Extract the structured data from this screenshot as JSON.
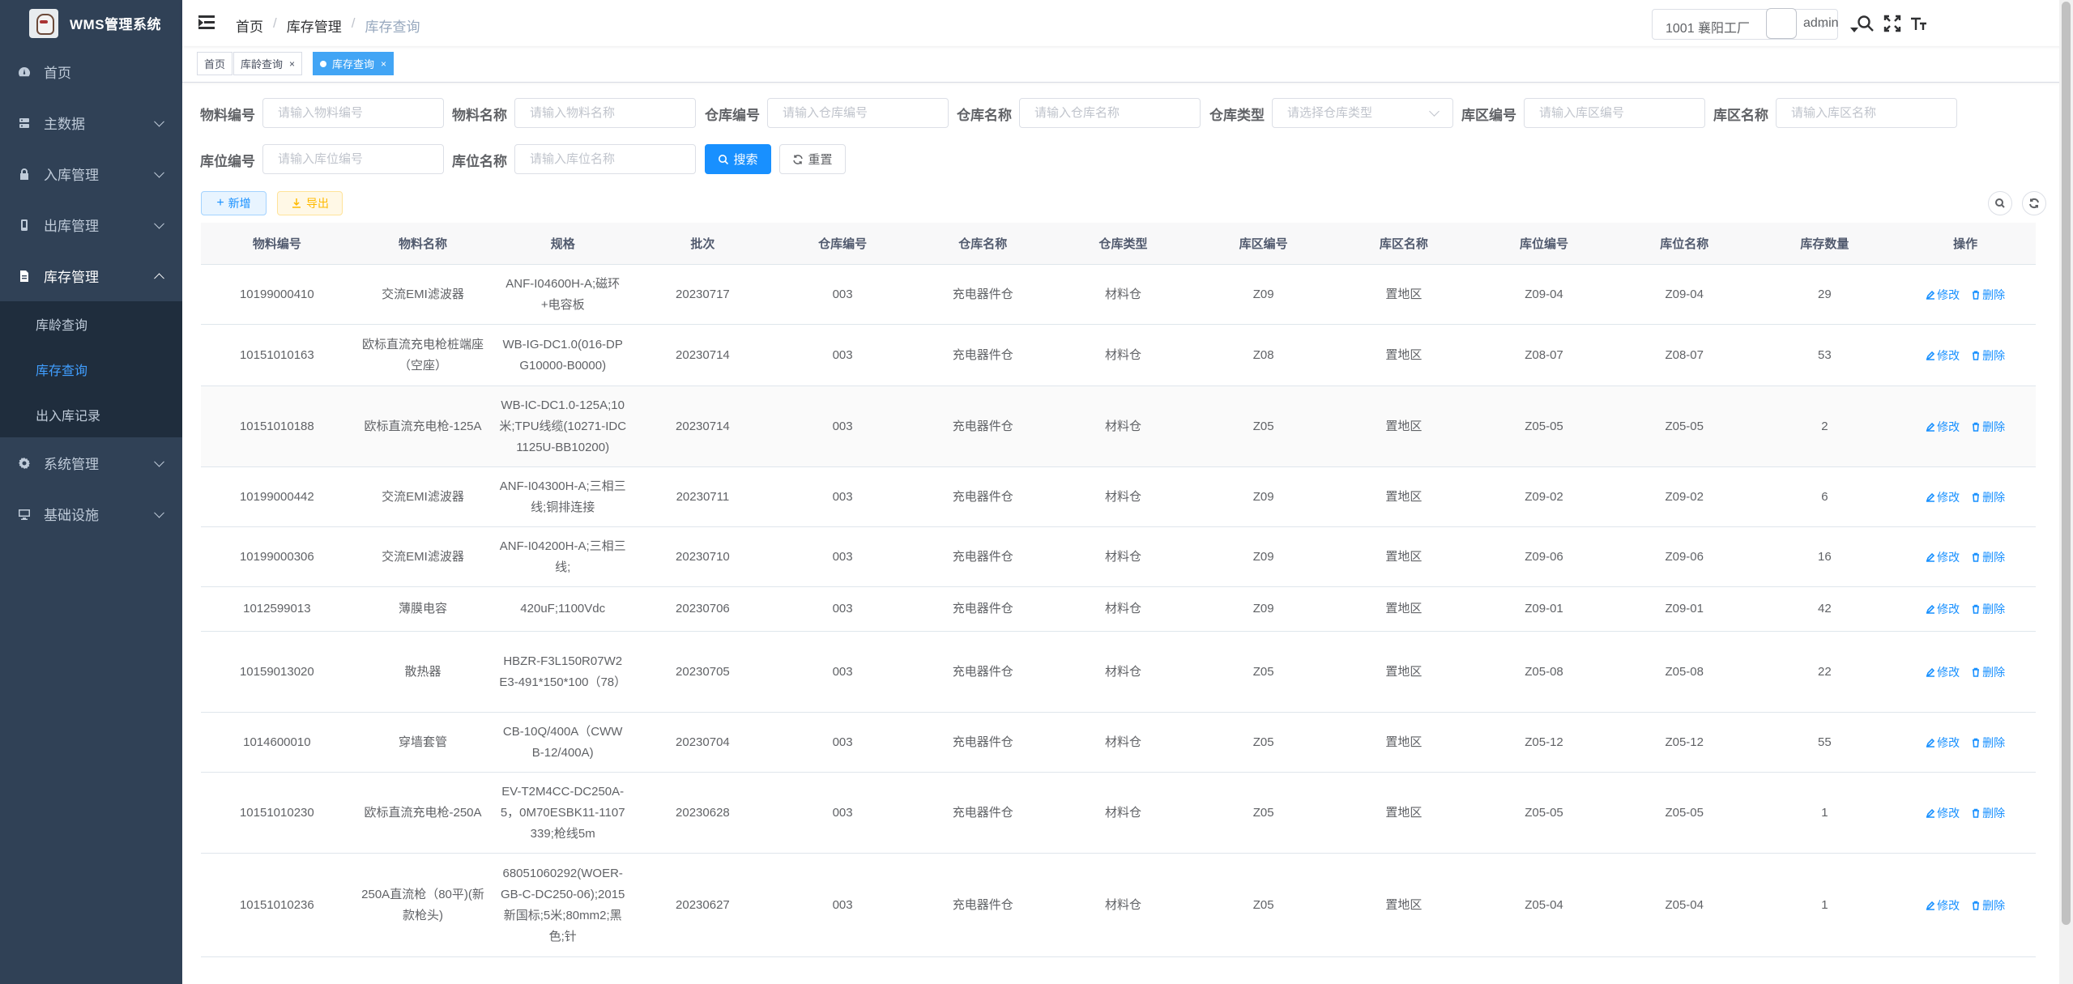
{
  "app": {
    "title": "WMS管理系统"
  },
  "sidebar": {
    "items": [
      {
        "label": "首页",
        "icon": "dashboard-icon"
      },
      {
        "label": "主数据",
        "icon": "server-icon"
      },
      {
        "label": "入库管理",
        "icon": "lock-icon"
      },
      {
        "label": "出库管理",
        "icon": "phone-icon"
      },
      {
        "label": "库存管理",
        "icon": "document-icon"
      },
      {
        "label": "系统管理",
        "icon": "gear-icon"
      },
      {
        "label": "基础设施",
        "icon": "monitor-icon"
      }
    ],
    "sub_items": [
      {
        "label": "库龄查询"
      },
      {
        "label": "库存查询"
      },
      {
        "label": "出入库记录"
      }
    ]
  },
  "navbar": {
    "breadcrumb": [
      "首页",
      "库存管理",
      "库存查询"
    ],
    "factory": "1001 襄阳工厂",
    "user": "admin"
  },
  "tags": [
    {
      "label": "首页"
    },
    {
      "label": "库龄查询"
    },
    {
      "label": "库存查询"
    }
  ],
  "filters": {
    "material_code": {
      "label": "物料编号",
      "placeholder": "请输入物料编号"
    },
    "material_name": {
      "label": "物料名称",
      "placeholder": "请输入物料名称"
    },
    "warehouse_code": {
      "label": "仓库编号",
      "placeholder": "请输入仓库编号"
    },
    "warehouse_name": {
      "label": "仓库名称",
      "placeholder": "请输入仓库名称"
    },
    "warehouse_type": {
      "label": "仓库类型",
      "placeholder": "请选择仓库类型"
    },
    "area_code": {
      "label": "库区编号",
      "placeholder": "请输入库区编号"
    },
    "area_name": {
      "label": "库区名称",
      "placeholder": "请输入库区名称"
    },
    "location_code": {
      "label": "库位编号",
      "placeholder": "请输入库位编号"
    },
    "location_name": {
      "label": "库位名称",
      "placeholder": "请输入库位名称"
    },
    "search_label": "搜索",
    "reset_label": "重置"
  },
  "toolbar": {
    "add_label": "新增",
    "export_label": "导出"
  },
  "table": {
    "columns": [
      "物料编号",
      "物料名称",
      "规格",
      "批次",
      "仓库编号",
      "仓库名称",
      "仓库类型",
      "库区编号",
      "库区名称",
      "库位编号",
      "库位名称",
      "库存数量",
      "操作"
    ],
    "edit_label": "修改",
    "delete_label": "删除",
    "rows": [
      [
        "10199000410",
        "交流EMI滤波器",
        "ANF-I04600H-A;磁环+电容板",
        "20230717",
        "003",
        "充电器件仓",
        "材料仓",
        "Z09",
        "置地区",
        "Z09-04",
        "Z09-04",
        "29"
      ],
      [
        "10151010163",
        "欧标直流充电枪桩端座（空座）",
        "WB-IG-DC1.0(016-DPG10000-B0000)",
        "20230714",
        "003",
        "充电器件仓",
        "材料仓",
        "Z08",
        "置地区",
        "Z08-07",
        "Z08-07",
        "53"
      ],
      [
        "10151010188",
        "欧标直流充电枪-125A",
        "WB-IC-DC1.0-125A;10米;TPU线缆(10271-IDC1125U-BB10200)",
        "20230714",
        "003",
        "充电器件仓",
        "材料仓",
        "Z05",
        "置地区",
        "Z05-05",
        "Z05-05",
        "2"
      ],
      [
        "10199000442",
        "交流EMI滤波器",
        "ANF-I04300H-A;三相三线;铜排连接",
        "20230711",
        "003",
        "充电器件仓",
        "材料仓",
        "Z09",
        "置地区",
        "Z09-02",
        "Z09-02",
        "6"
      ],
      [
        "10199000306",
        "交流EMI滤波器",
        "ANF-I04200H-A;三相三线;",
        "20230710",
        "003",
        "充电器件仓",
        "材料仓",
        "Z09",
        "置地区",
        "Z09-06",
        "Z09-06",
        "16"
      ],
      [
        "1012599013",
        "薄膜电容",
        "420uF;1100Vdc",
        "20230706",
        "003",
        "充电器件仓",
        "材料仓",
        "Z09",
        "置地区",
        "Z09-01",
        "Z09-01",
        "42"
      ],
      [
        "10159013020",
        "散热器",
        "HBZR-F3L150R07W2E3-491*150*100（78）",
        "20230705",
        "003",
        "充电器件仓",
        "材料仓",
        "Z05",
        "置地区",
        "Z05-08",
        "Z05-08",
        "22"
      ],
      [
        "1014600010",
        "穿墙套管",
        "CB-10Q/400A（CWWB-12/400A)",
        "20230704",
        "003",
        "充电器件仓",
        "材料仓",
        "Z05",
        "置地区",
        "Z05-12",
        "Z05-12",
        "55"
      ],
      [
        "10151010230",
        "欧标直流充电枪-250A",
        "EV-T2M4CC-DC250A-5，0M70ESBK11-1107339;枪线5m",
        "20230628",
        "003",
        "充电器件仓",
        "材料仓",
        "Z05",
        "置地区",
        "Z05-05",
        "Z05-05",
        "1"
      ],
      [
        "10151010236",
        "250A直流枪（80平)(新款枪头)",
        "68051060292(WOER-GB-C-DC250-06);2015新国标;5米;80mm2;黑色;针",
        "20230627",
        "003",
        "充电器件仓",
        "材料仓",
        "Z05",
        "置地区",
        "Z05-04",
        "Z05-04",
        "1"
      ]
    ]
  }
}
